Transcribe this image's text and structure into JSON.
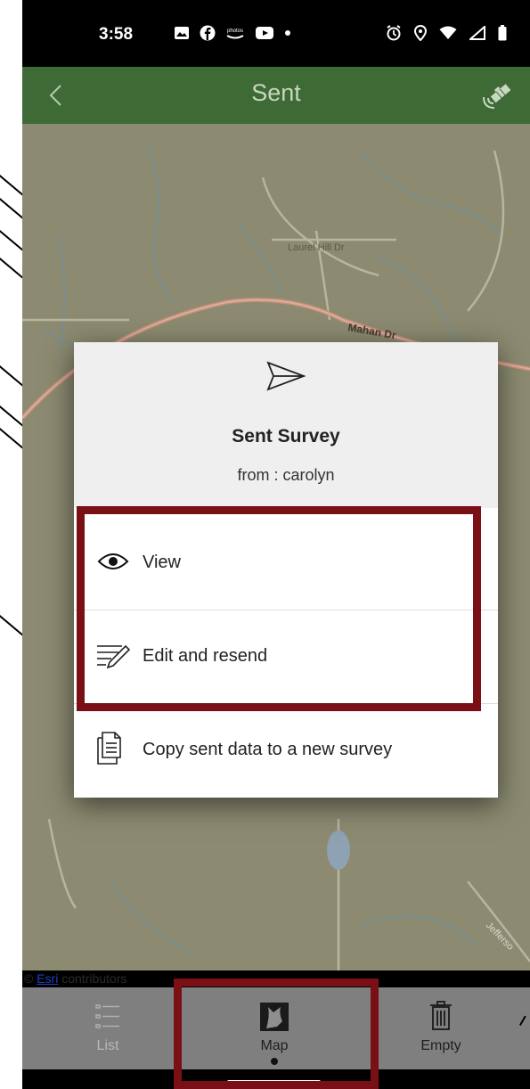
{
  "status_bar": {
    "time": "3:58",
    "left_icons": [
      "image-icon",
      "facebook-icon",
      "photos-icon",
      "youtube-icon",
      "dot-icon"
    ],
    "right_icons": [
      "alarm-icon",
      "location-icon",
      "wifi-icon",
      "signal-icon",
      "battery-icon"
    ]
  },
  "app_bar": {
    "title": "Sent",
    "back_icon": "chevron-left-icon",
    "gps_icon": "satellite-icon"
  },
  "map": {
    "road_labels": [
      "Laurel Hill Dr",
      "Mahan Dr",
      "Jefferso"
    ],
    "attribution_prefix": "© ",
    "attribution_link": "Esri",
    "attribution_suffix": " contributors"
  },
  "dialog": {
    "icon": "paper-plane-icon",
    "title": "Sent Survey",
    "subtitle": "from : carolyn",
    "items": [
      {
        "label": "View",
        "icon": "eye-icon"
      },
      {
        "label": "Edit and resend",
        "icon": "edit-lines-icon"
      },
      {
        "label": "Copy sent data to a new survey",
        "icon": "copy-document-icon"
      }
    ]
  },
  "bottom_nav": {
    "items": [
      {
        "label": "List",
        "icon": "list-icon",
        "active": false
      },
      {
        "label": "Map",
        "icon": "map-icon",
        "active": true
      },
      {
        "label": "Empty",
        "icon": "trash-icon",
        "active": false
      }
    ]
  },
  "colors": {
    "app_bar": "#3e6a35",
    "highlight": "#7a1015",
    "map": "#8c8b71",
    "bottom_nav": "#7f7f7f"
  }
}
